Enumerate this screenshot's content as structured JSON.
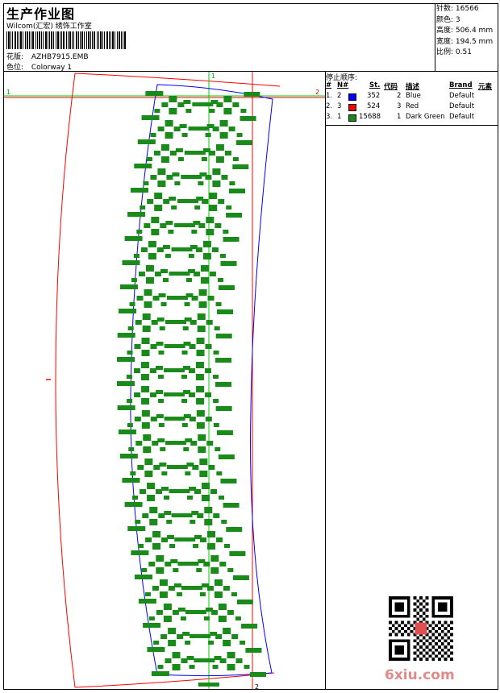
{
  "header": {
    "title": "生产作业图",
    "company": "Wilcom(汇宏) 绣饰工作室",
    "design_label": "花版:",
    "design_value": "AZHB7915.EMB",
    "colorway_label": "色位:",
    "colorway_value": "Colorway 1"
  },
  "stats": {
    "stitches_label": "针数:",
    "stitches_value": "16566",
    "colors_label": "颜色:",
    "colors_value": "3",
    "height_label": "高度:",
    "height_value": "506.4 mm",
    "width_label": "宽度:",
    "width_value": "194.5 mm",
    "scale_label": "比例:",
    "scale_value": "0.51"
  },
  "stop_sequence": {
    "title": "停止顺序:",
    "headers": [
      "#",
      "N#",
      "St.",
      "代码",
      "描述",
      "Brand",
      "元素"
    ],
    "rows": [
      {
        "num": "1.",
        "n": "2",
        "color": "#0000ff",
        "st": "352",
        "code": "2",
        "desc": "Blue",
        "brand": "Default"
      },
      {
        "num": "2.",
        "n": "3",
        "color": "#ff0000",
        "st": "524",
        "code": "3",
        "desc": "Red",
        "brand": "Default"
      },
      {
        "num": "3.",
        "n": "1",
        "color": "#1a8a1a",
        "st": "15688",
        "code": "1",
        "desc": "Dark Green",
        "brand": "Default"
      }
    ]
  },
  "guides": {
    "h_left": "1",
    "h_right": "2",
    "v_top": "1",
    "v_bottom": "2"
  },
  "colors": {
    "thread_green": "#1a8a1a",
    "thread_blue": "#0000ff",
    "thread_red": "#ff0000",
    "guide_green": "#00cc00"
  },
  "watermark": {
    "site": "6xiu.com"
  }
}
